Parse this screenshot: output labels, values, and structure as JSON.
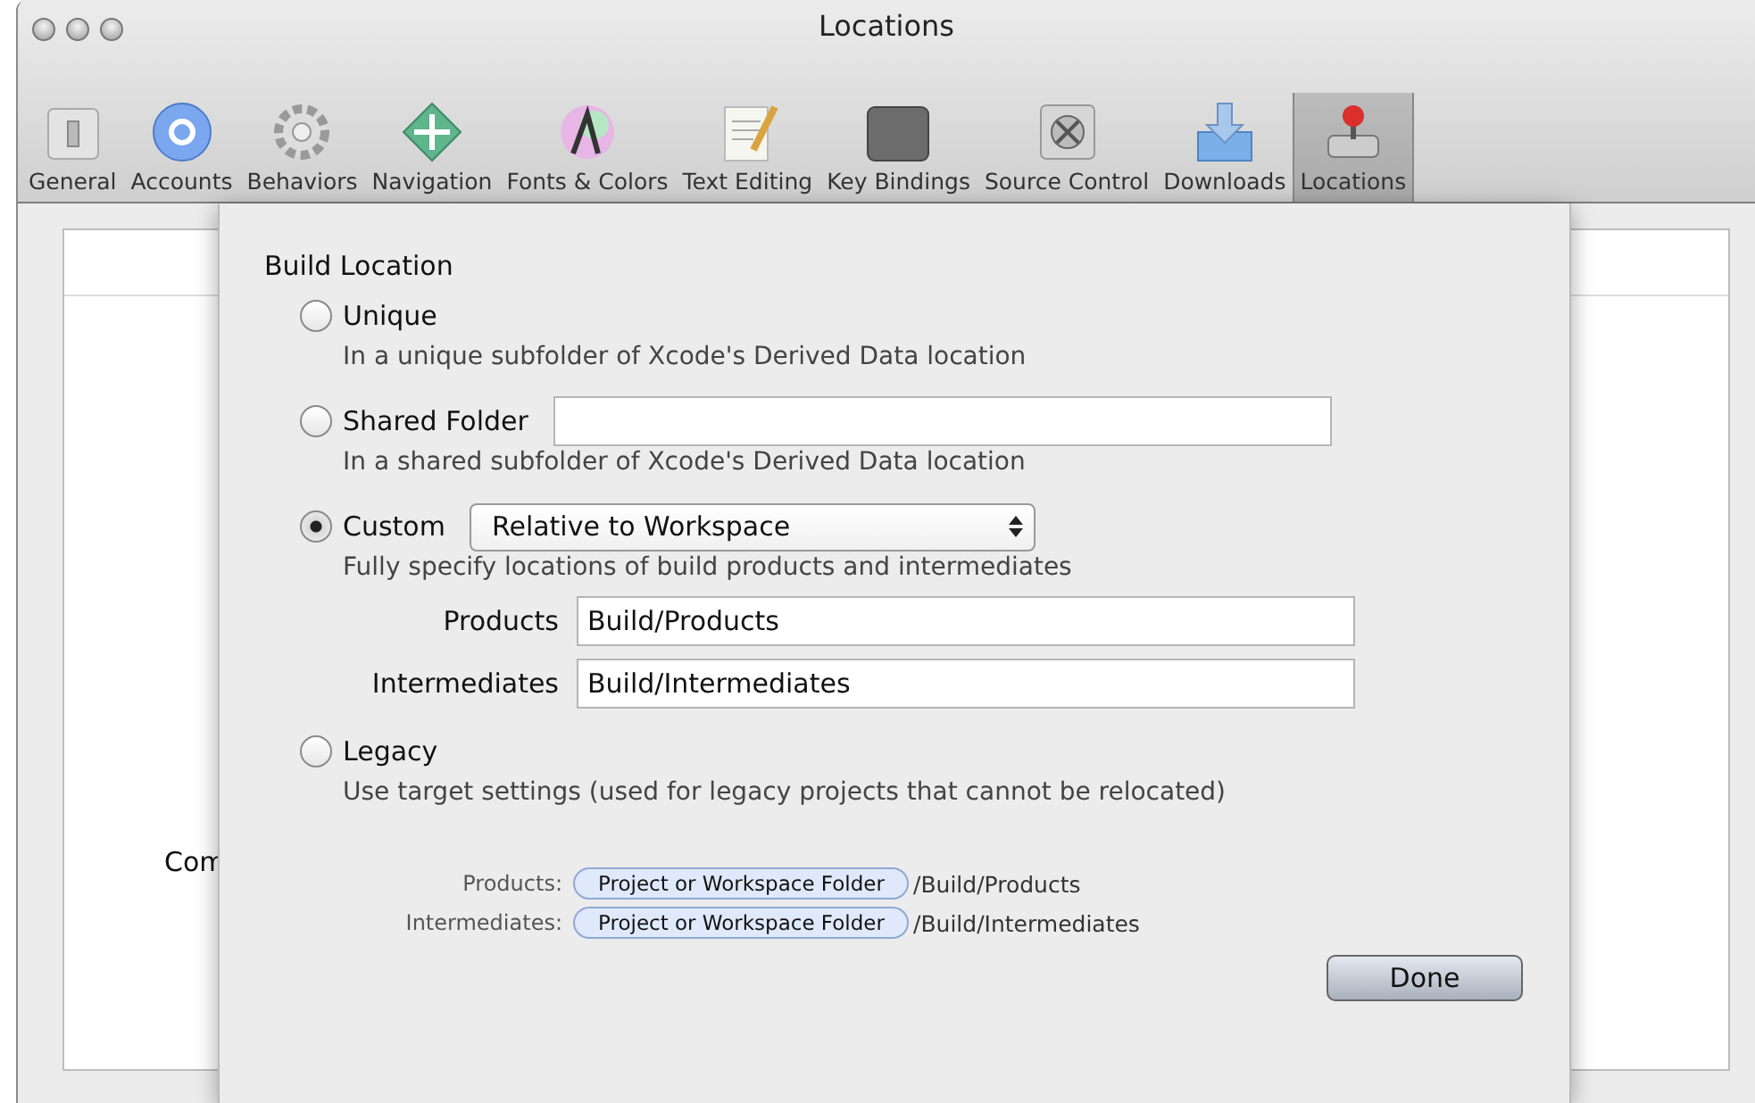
{
  "window": {
    "title": "Locations"
  },
  "toolbar": {
    "items": [
      {
        "label": "General",
        "selected": false
      },
      {
        "label": "Accounts",
        "selected": false
      },
      {
        "label": "Behaviors",
        "selected": false
      },
      {
        "label": "Navigation",
        "selected": false
      },
      {
        "label": "Fonts & Colors",
        "selected": false
      },
      {
        "label": "Text Editing",
        "selected": false
      },
      {
        "label": "Key Bindings",
        "selected": false
      },
      {
        "label": "Source Control",
        "selected": false
      },
      {
        "label": "Downloads",
        "selected": false
      },
      {
        "label": "Locations",
        "selected": true
      }
    ]
  },
  "background": {
    "command_label": "Com"
  },
  "sheet": {
    "heading": "Build Location",
    "options": [
      {
        "kind": "plain",
        "label": "Unique",
        "selected": false,
        "description": "In a unique subfolder of Xcode's Derived Data location"
      },
      {
        "kind": "field",
        "label": "Shared Folder",
        "selected": false,
        "description": "In a shared subfolder of Xcode's Derived Data location"
      },
      {
        "kind": "popup",
        "label": "Custom",
        "selected": true,
        "popup": "Relative to Workspace",
        "description": "Fully specify locations of build products and intermediates",
        "paths": [
          {
            "label": "Products",
            "value": "Build/Products"
          },
          {
            "label": "Intermediates",
            "value": "Build/Intermediates"
          }
        ]
      },
      {
        "kind": "plain",
        "label": "Legacy",
        "selected": false,
        "description": "Use target settings (used for legacy projects that cannot be relocated)"
      }
    ],
    "preview": [
      {
        "label": "Products:",
        "token": "Project or Workspace Folder",
        "suffix": "/Build/Products"
      },
      {
        "label": "Intermediates:",
        "token": "Project or Workspace Folder",
        "suffix": "/Build/Intermediates"
      }
    ],
    "done_button": "Done"
  }
}
